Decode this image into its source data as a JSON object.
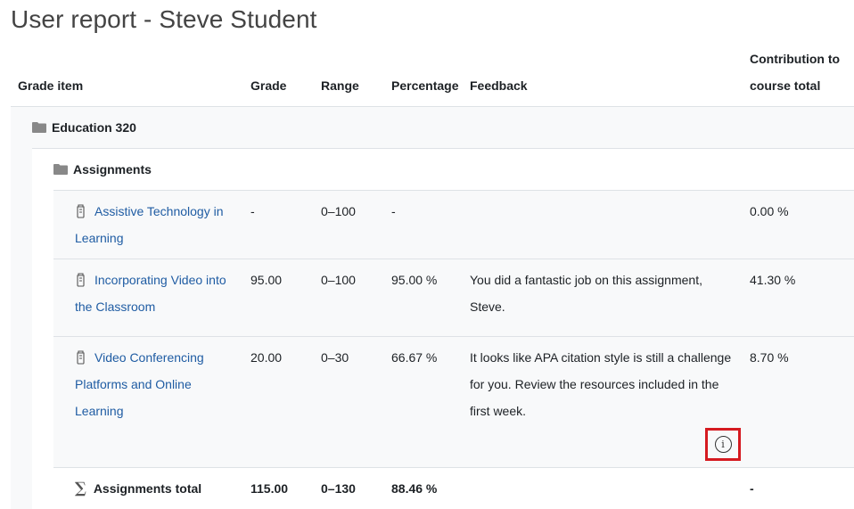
{
  "title": "User report - Steve Student",
  "columns": {
    "grade_item": "Grade item",
    "grade": "Grade",
    "range": "Range",
    "percentage": "Percentage",
    "feedback": "Feedback",
    "contribution_line1": "Contribution to",
    "contribution_line2": "course total"
  },
  "course": {
    "name": "Education 320",
    "icon": "folder-icon"
  },
  "category": {
    "name": "Assignments",
    "icon": "folder-icon"
  },
  "items": [
    {
      "name_line1": "Assistive Technology in",
      "name_line2": "Learning",
      "name_line3": "",
      "icon": "assignment-icon",
      "grade": "-",
      "range": "0–100",
      "percentage": "-",
      "feedback_line1": "",
      "feedback_line2": "",
      "feedback_line3": "",
      "contribution": "0.00 %"
    },
    {
      "name_line1": "Incorporating Video into",
      "name_line2": "the Classroom",
      "name_line3": "",
      "icon": "assignment-icon",
      "grade": "95.00",
      "range": "0–100",
      "percentage": "95.00 %",
      "feedback_line1": "You did a fantastic job on this assignment,",
      "feedback_line2": "Steve.",
      "feedback_line3": "",
      "contribution": "41.30 %"
    },
    {
      "name_line1": "Video Conferencing",
      "name_line2": "Platforms and Online",
      "name_line3": "Learning",
      "icon": "assignment-icon",
      "grade": "20.00",
      "range": "0–30",
      "percentage": "66.67 %",
      "feedback_line1": "It looks like APA citation style is still a challenge",
      "feedback_line2": "for you.  Review the resources included in the",
      "feedback_line3": "first week.",
      "contribution": "8.70 %",
      "info_icon": "info-icon"
    }
  ],
  "total": {
    "icon": "sigma-icon",
    "symbol": "∑",
    "name": "Assignments total",
    "grade": "115.00",
    "range": "0–130",
    "percentage": "88.46 %",
    "contribution": "-"
  },
  "colors": {
    "link": "#1f5ca3",
    "highlight": "#d51a20",
    "row_band": "#f8f9fa",
    "border": "#dee2e6"
  }
}
